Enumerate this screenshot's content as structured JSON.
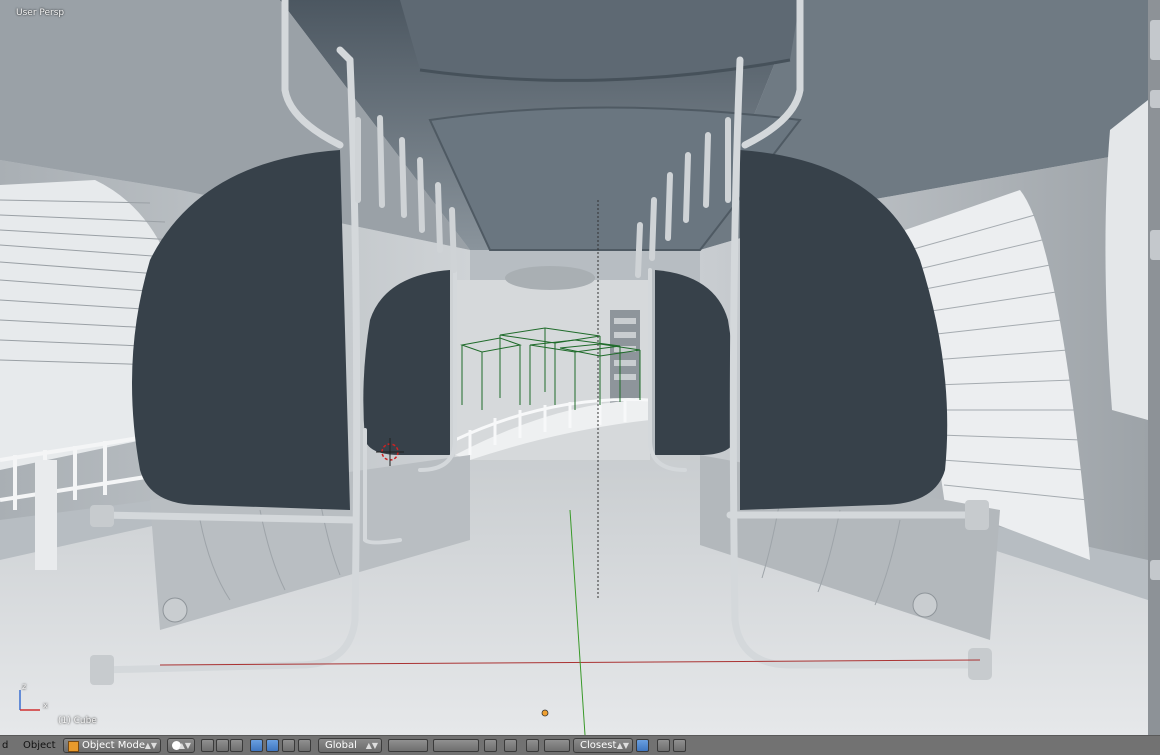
{
  "viewport": {
    "view_label": "User Persp",
    "object_label": "(1) Cube",
    "axis_gizmo": {
      "x": "x",
      "z": "z"
    },
    "colors": {
      "seat_shell": "#37414a",
      "wall": "#c3c8cc",
      "floor": "#dcdfe1",
      "ceiling": "#5a656e",
      "wire": "#1f6b2a"
    }
  },
  "header": {
    "editor_fragment": "d",
    "object_menu": "Object",
    "mode": "Object Mode",
    "orientation": "Global",
    "snap_target": "Closest"
  }
}
